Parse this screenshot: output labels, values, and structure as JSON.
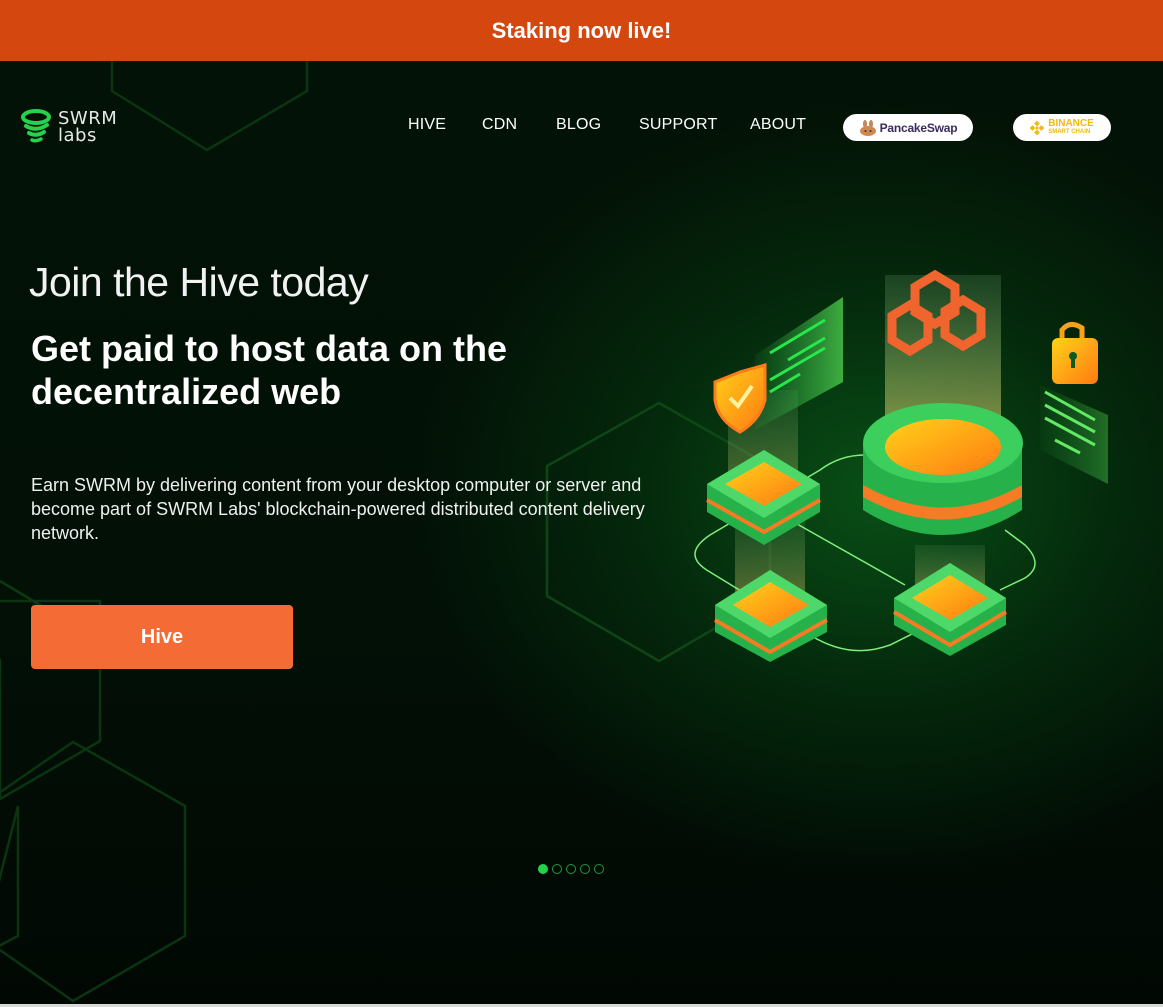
{
  "banner": {
    "text": "Staking now live!"
  },
  "brand": {
    "line1": "SWRM",
    "line2": "labs",
    "logo_icon": "tornado-logo-icon"
  },
  "nav": {
    "items": [
      {
        "label": "HIVE"
      },
      {
        "label": "CDN"
      },
      {
        "label": "BLOG"
      },
      {
        "label": "SUPPORT"
      },
      {
        "label": "ABOUT"
      }
    ],
    "exchanges": [
      {
        "label": "PancakeSwap",
        "icon": "bunny-icon"
      },
      {
        "label_line1": "BINANCE",
        "label_line2": "SMART CHAIN",
        "icon": "binance-diamond-icon"
      }
    ]
  },
  "hero": {
    "kicker": "Join the Hive today",
    "headline": "Get paid to host data on the decentralized web",
    "description": "Earn SWRM by delivering content from your desktop computer or server and become part of SWRM Labs' blockchain-powered distributed content delivery network.",
    "cta_label": "Hive",
    "carousel": {
      "total_slides": 5,
      "active_slide": 1
    }
  },
  "colors": {
    "banner": "#d4470e",
    "cta": "#f46b35",
    "accent_green": "#26d14b",
    "background": "#020a03"
  }
}
